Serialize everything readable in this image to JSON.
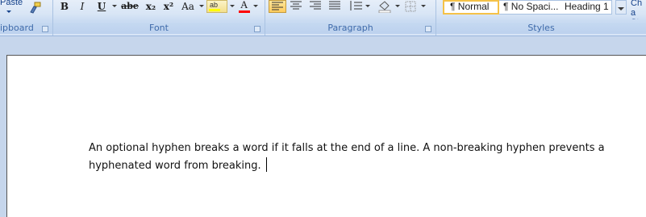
{
  "ribbon": {
    "clipboard": {
      "paste_label": "Paste",
      "group_label": "ipboard"
    },
    "font": {
      "group_label": "Font",
      "bold": "B",
      "italic": "I",
      "underline": "U",
      "strike": "abe",
      "subscript": "x₂",
      "superscript": "x²",
      "change_case": "Aa",
      "highlight_color": "#ffff00",
      "font_color": "#ff0000",
      "font_color_glyph": "A"
    },
    "paragraph": {
      "group_label": "Paragraph"
    },
    "styles": {
      "group_label": "Styles",
      "items": [
        "¶ Normal",
        "¶ No Spaci...",
        "Heading 1"
      ],
      "change_styles_label": "Cha St"
    }
  },
  "document": {
    "body_text": "An optional hyphen breaks a word if it falls at the end of a line. A non-breaking hyphen prevents a hyphenated word from breaking."
  }
}
